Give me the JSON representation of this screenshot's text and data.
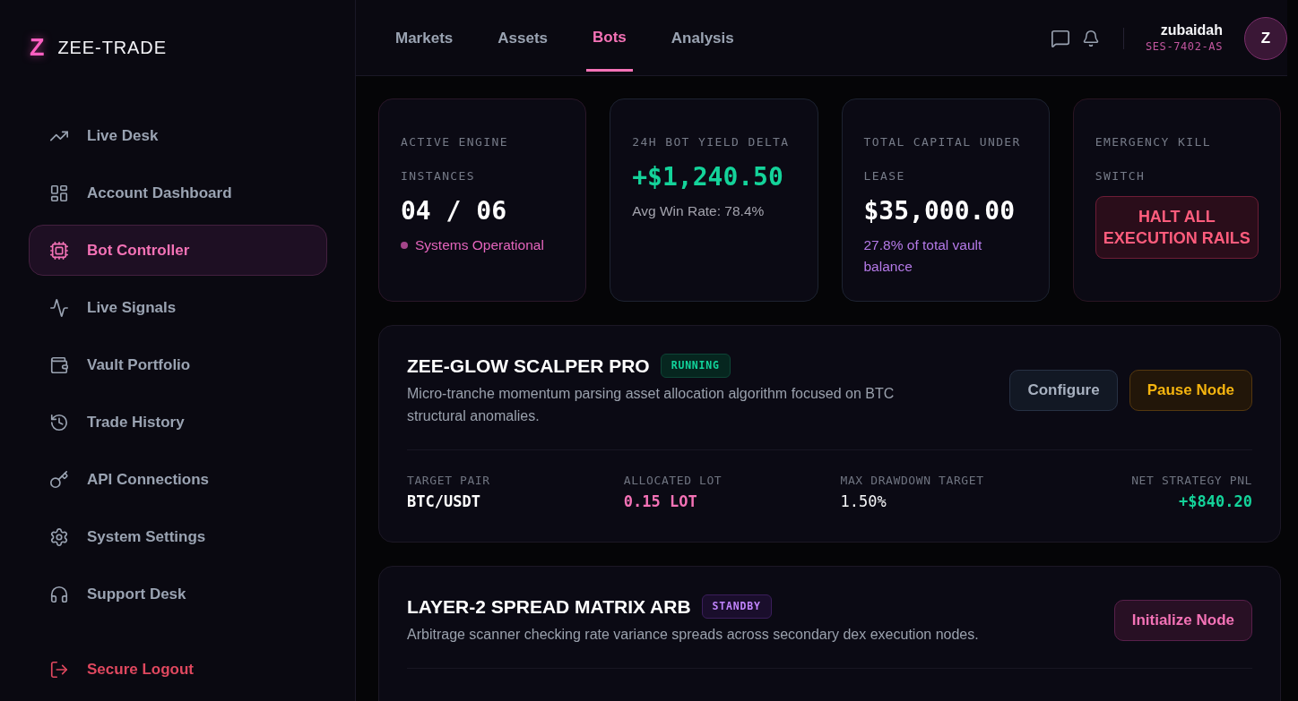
{
  "brand": {
    "mark": "Z",
    "name": "ZEE-TRADE"
  },
  "sidebar": {
    "items": [
      {
        "label": "Live Desk",
        "selected": false
      },
      {
        "label": "Account Dashboard",
        "selected": false
      },
      {
        "label": "Bot Controller",
        "selected": true
      },
      {
        "label": "Live Signals",
        "selected": false
      },
      {
        "label": "Vault Portfolio",
        "selected": false
      },
      {
        "label": "Trade History",
        "selected": false
      },
      {
        "label": "API Connections",
        "selected": false
      },
      {
        "label": "System Settings",
        "selected": false
      },
      {
        "label": "Support Desk",
        "selected": false
      }
    ],
    "logout": {
      "label": "Secure Logout"
    }
  },
  "topbar": {
    "tabs": [
      {
        "label": "Markets",
        "selected": false
      },
      {
        "label": "Assets",
        "selected": false
      },
      {
        "label": "Bots",
        "selected": true
      },
      {
        "label": "Analysis",
        "selected": false
      }
    ],
    "user": {
      "name": "zubaidah",
      "session": "SES-7402-AS",
      "initial": "Z"
    }
  },
  "stats": [
    {
      "kind": "status",
      "label": "ACTIVE ENGINE INSTANCES",
      "value": "04 / 06",
      "note": "Systems Operational"
    },
    {
      "kind": "gain",
      "label": "24H BOT YIELD DELTA",
      "value": "+$1,240.50",
      "note": "Avg Win Rate: 78.4%"
    },
    {
      "kind": "capital",
      "label": "TOTAL CAPITAL UNDER LEASE",
      "value": "$35,000.00",
      "note": "27.8% of total vault balance"
    },
    {
      "kind": "switch",
      "label": "EMERGENCY KILL SWITCH",
      "action": "HALT ALL EXECUTION RAILS"
    }
  ],
  "bots": [
    {
      "name": "ZEE-GLOW SCALPER PRO",
      "status": {
        "kind": "running",
        "label": "RUNNING"
      },
      "description": "Micro-tranche momentum parsing asset allocation algorithm focused on BTC structural anomalies.",
      "actions": [
        {
          "kind": "secondary",
          "label": "Configure"
        },
        {
          "kind": "warning",
          "label": "Pause Node"
        }
      ],
      "metrics": [
        {
          "kind": "pair",
          "label": "TARGET PAIR",
          "value": "BTC/USDT"
        },
        {
          "kind": "lot",
          "label": "ALLOCATED LOT",
          "value": "0.15 LOT"
        },
        {
          "kind": "plain",
          "label": "MAX DRAWDOWN TARGET",
          "value": "1.50%"
        },
        {
          "kind": "gain",
          "label": "NET STRATEGY PNL",
          "value": "+$840.20"
        }
      ]
    },
    {
      "name": "LAYER-2 SPREAD MATRIX ARB",
      "status": {
        "kind": "standby",
        "label": "STANDBY"
      },
      "description": "Arbitrage scanner checking rate variance spreads across secondary dex execution nodes.",
      "actions": [
        {
          "kind": "primary",
          "label": "Initialize Node"
        }
      ]
    }
  ]
}
